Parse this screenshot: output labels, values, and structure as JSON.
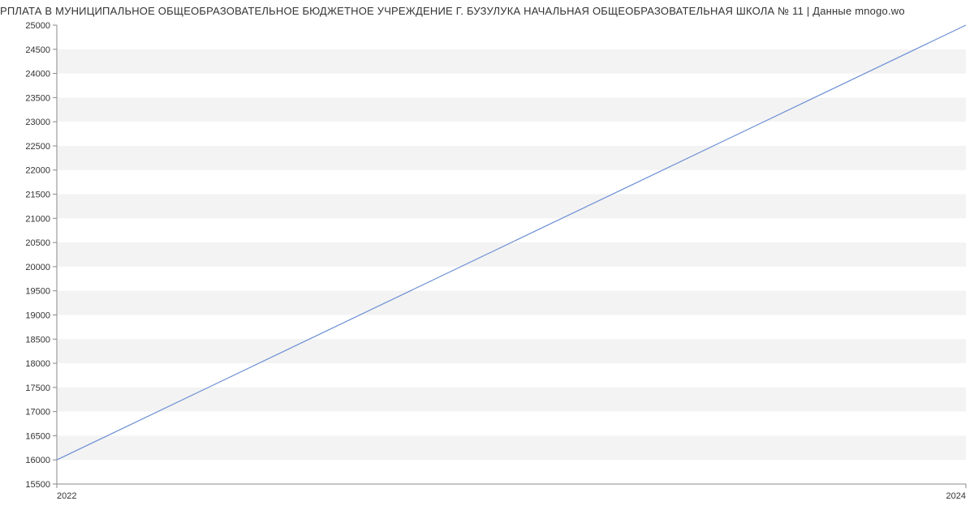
{
  "title": "РПЛАТА В МУНИЦИПАЛЬНОЕ ОБЩЕОБРАЗОВАТЕЛЬНОЕ БЮДЖЕТНОЕ УЧРЕЖДЕНИЕ Г. БУЗУЛУКА НАЧАЛЬНАЯ ОБЩЕОБРАЗОВАТЕЛЬНАЯ ШКОЛА № 11 | Данные mnogo.wo",
  "chart_data": {
    "type": "line",
    "x": [
      2022,
      2024
    ],
    "values": [
      16000,
      25000
    ],
    "title": "РПЛАТА В МУНИЦИПАЛЬНОЕ ОБЩЕОБРАЗОВАТЕЛЬНОЕ БЮДЖЕТНОЕ УЧРЕЖДЕНИЕ Г. БУЗУЛУКА НАЧАЛЬНАЯ ОБЩЕОБРАЗОВАТЕЛЬНАЯ ШКОЛА № 11 | Данные mnogo.wo",
    "xlabel": "",
    "ylabel": "",
    "xlim": [
      2022,
      2024
    ],
    "ylim": [
      15500,
      25000
    ],
    "xticks": [
      2022,
      2024
    ],
    "yticks": [
      15500,
      16000,
      16500,
      17000,
      17500,
      18000,
      18500,
      19000,
      19500,
      20000,
      20500,
      21000,
      21500,
      22000,
      22500,
      23000,
      23500,
      24000,
      24500,
      25000
    ],
    "line_color": "#6b8fd4"
  }
}
